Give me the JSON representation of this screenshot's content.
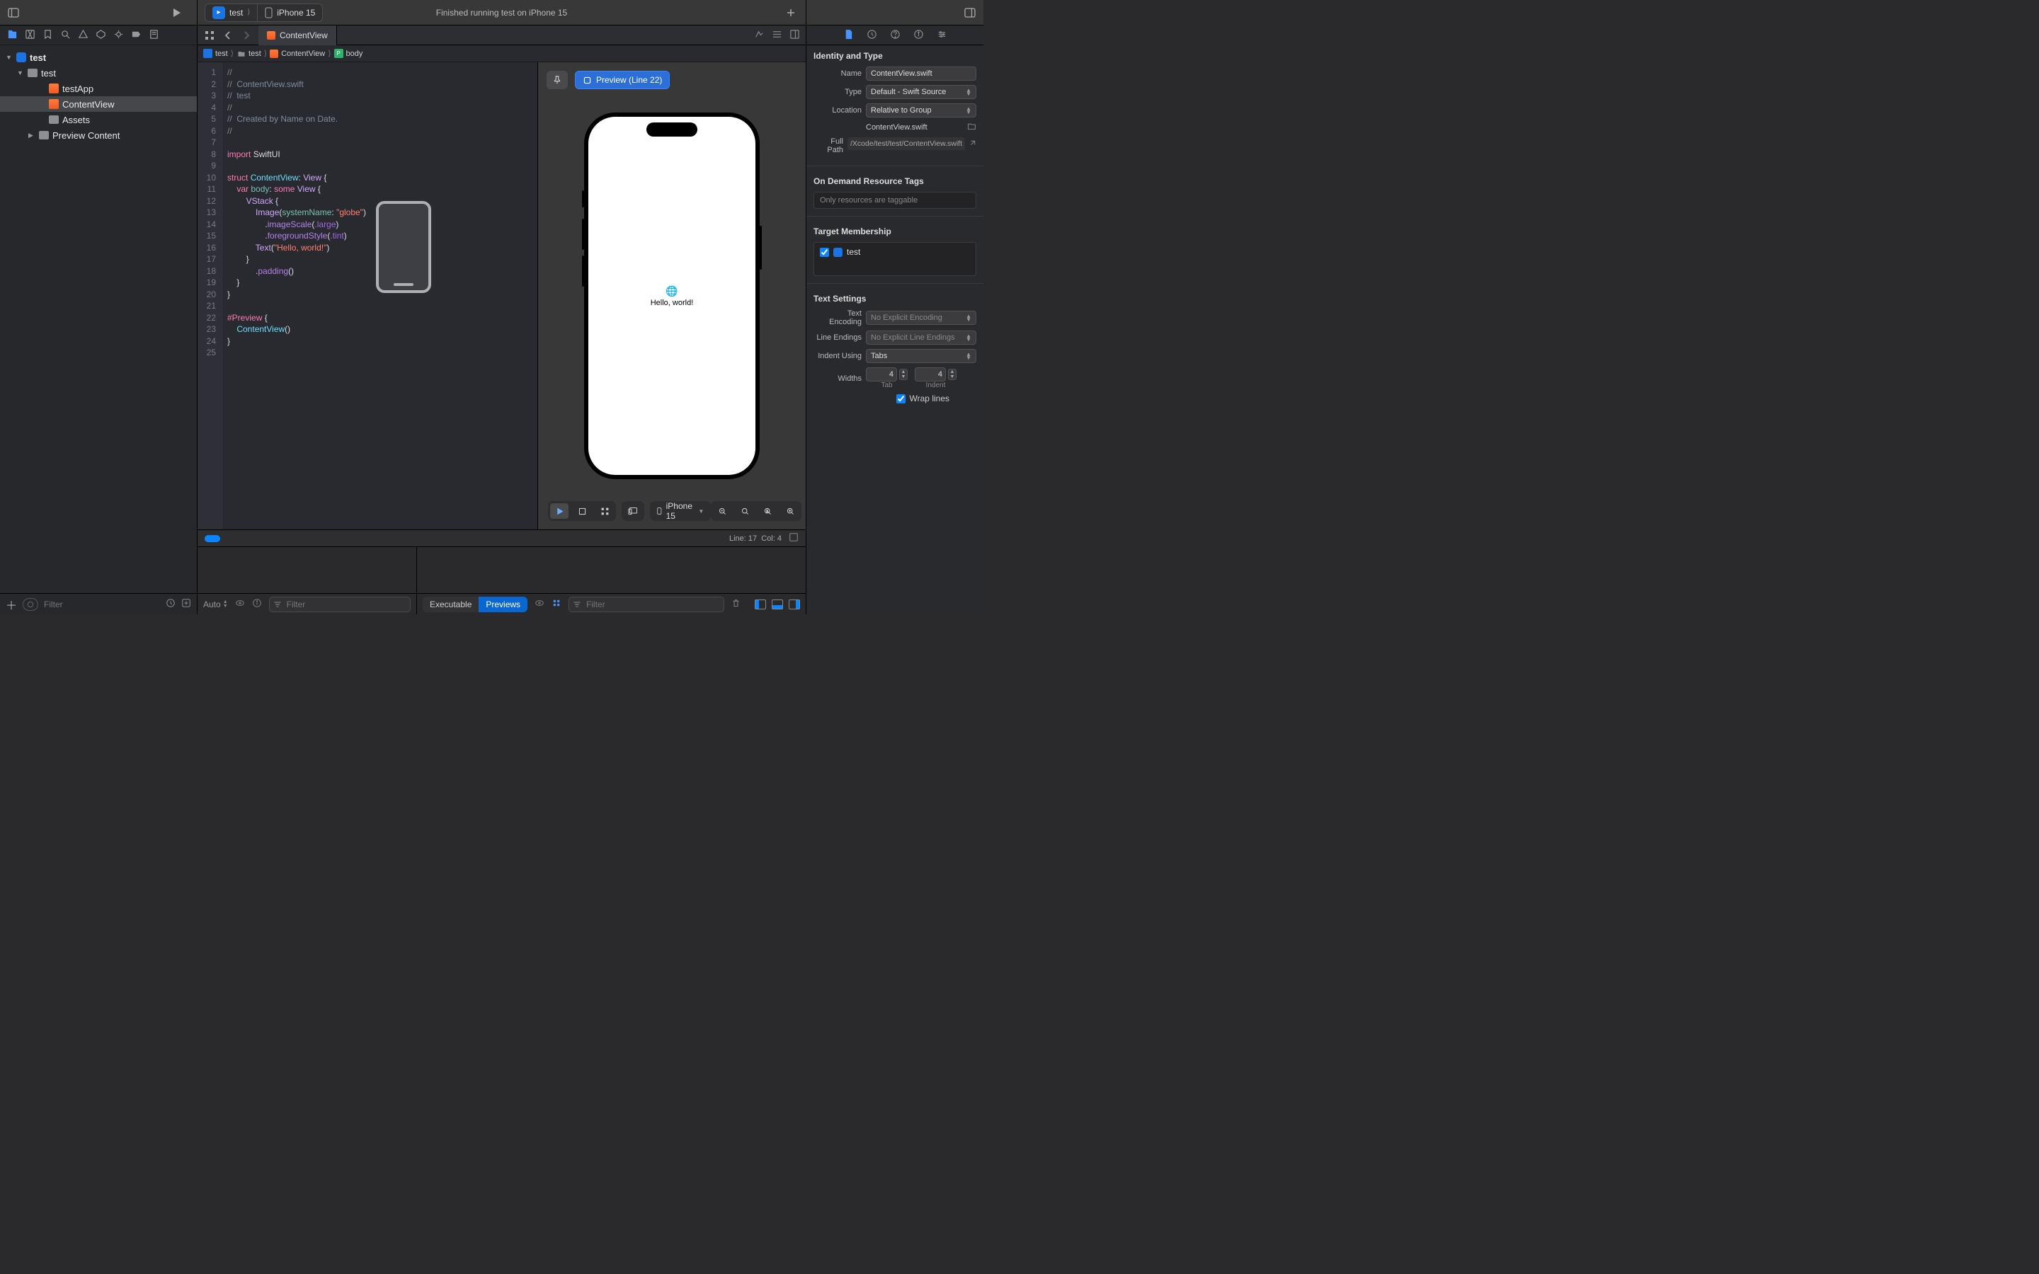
{
  "toolbar": {
    "scheme_name": "test",
    "device_name": "iPhone 15",
    "status": "Finished running test on iPhone 15"
  },
  "navigator": {
    "filter_placeholder": "Filter",
    "tree": {
      "root": "test",
      "group": "test",
      "items": [
        "testApp",
        "ContentView",
        "Assets",
        "Preview Content"
      ],
      "selected": "ContentView"
    }
  },
  "tab": {
    "title": "ContentView"
  },
  "jumpbar": {
    "crumbs": [
      "test",
      "test",
      "ContentView",
      "body"
    ]
  },
  "code": {
    "lines": [
      {
        "n": 1,
        "t": "comment",
        "s": "//"
      },
      {
        "n": 2,
        "t": "comment",
        "s": "//  ContentView.swift"
      },
      {
        "n": 3,
        "t": "comment",
        "s": "//  test"
      },
      {
        "n": 4,
        "t": "comment",
        "s": "//"
      },
      {
        "n": 5,
        "t": "comment",
        "s": "//  Created by Name on Date."
      },
      {
        "n": 6,
        "t": "comment",
        "s": "//"
      },
      {
        "n": 7,
        "t": "blank",
        "s": ""
      },
      {
        "n": 8,
        "t": "import",
        "kw": "import",
        "mod": "SwiftUI"
      },
      {
        "n": 9,
        "t": "blank",
        "s": ""
      },
      {
        "n": 10,
        "t": "struct",
        "kw": "struct",
        "name": "ContentView",
        "proto": "View"
      },
      {
        "n": 11,
        "t": "var",
        "indent": 1,
        "kw": "var",
        "name": "body",
        "some": "some",
        "type": "View"
      },
      {
        "n": 12,
        "t": "call",
        "indent": 2,
        "name": "VStack",
        "open": "{"
      },
      {
        "n": 13,
        "t": "call2",
        "indent": 3,
        "name": "Image",
        "label": "systemName",
        "str": "\"globe\""
      },
      {
        "n": 14,
        "t": "mod",
        "indent": 4,
        "name": "imageScale",
        "arg": ".large"
      },
      {
        "n": 15,
        "t": "mod",
        "indent": 4,
        "name": "foregroundStyle",
        "arg": ".tint"
      },
      {
        "n": 16,
        "t": "call3",
        "indent": 3,
        "name": "Text",
        "str": "\"Hello, world!\""
      },
      {
        "n": 17,
        "t": "close",
        "indent": 2,
        "s": "}"
      },
      {
        "n": 18,
        "t": "mod",
        "indent": 3,
        "name": "padding",
        "arg": ""
      },
      {
        "n": 19,
        "t": "close",
        "indent": 1,
        "s": "}"
      },
      {
        "n": 20,
        "t": "close",
        "indent": 0,
        "s": "}"
      },
      {
        "n": 21,
        "t": "blank",
        "s": ""
      },
      {
        "n": 22,
        "t": "preview",
        "kw": "#Preview"
      },
      {
        "n": 23,
        "t": "call4",
        "indent": 1,
        "name": "ContentView"
      },
      {
        "n": 24,
        "t": "close",
        "indent": 0,
        "s": "}"
      },
      {
        "n": 25,
        "t": "blank",
        "s": ""
      }
    ],
    "highlight_line": 17
  },
  "statusbar": {
    "line_label": "Line:",
    "line": 17,
    "col_label": "Col:",
    "col": 4
  },
  "canvas": {
    "preview_chip": "Preview (Line 22)",
    "app_text": "Hello, world!",
    "device_picker": "iPhone 15"
  },
  "debug": {
    "left": {
      "auto": "Auto",
      "filter_placeholder": "Filter"
    },
    "right": {
      "seg_exec": "Executable",
      "seg_prev": "Previews",
      "filter_placeholder": "Filter"
    }
  },
  "inspector": {
    "identity": {
      "header": "Identity and Type",
      "name_label": "Name",
      "name": "ContentView.swift",
      "type_label": "Type",
      "type": "Default - Swift Source",
      "location_label": "Location",
      "location": "Relative to Group",
      "location_file": "ContentView.swift",
      "fullpath_label": "Full Path",
      "fullpath": "/Xcode/test/test/ContentView.swift"
    },
    "odr": {
      "header": "On Demand Resource Tags",
      "placeholder": "Only resources are taggable"
    },
    "target": {
      "header": "Target Membership",
      "item": "test"
    },
    "text": {
      "header": "Text Settings",
      "enc_label": "Text Encoding",
      "enc": "No Explicit Encoding",
      "le_label": "Line Endings",
      "le": "No Explicit Line Endings",
      "indent_label": "Indent Using",
      "indent": "Tabs",
      "widths_label": "Widths",
      "tab_val": "4",
      "indent_val": "4",
      "tab_sub": "Tab",
      "indent_sub": "Indent",
      "wrap": "Wrap lines"
    }
  }
}
